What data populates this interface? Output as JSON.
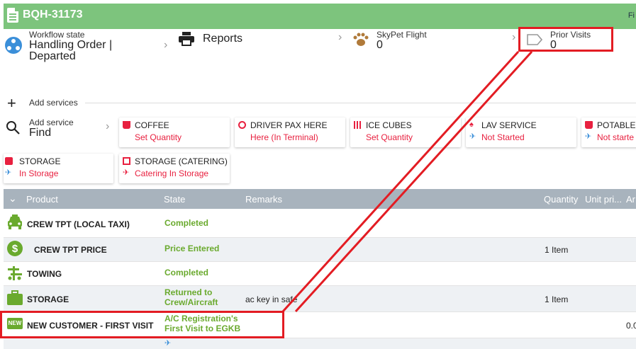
{
  "header": {
    "title": "BQH-31173",
    "right_text": "Fi"
  },
  "workflow": {
    "label": "Workflow state",
    "value_line1": "Handling Order |",
    "value_line2": "Departed"
  },
  "reports": {
    "label": "Reports"
  },
  "skypet": {
    "label": "SkyPet Flight",
    "value": "0"
  },
  "prior_visits": {
    "label": "Prior Visits",
    "value": "0"
  },
  "add_services": {
    "label": "Add services"
  },
  "add_service_find": {
    "label": "Add service",
    "value": "Find"
  },
  "services": [
    {
      "name": "COFFEE",
      "state": "Set Quantity",
      "icon": "coffee-icon"
    },
    {
      "name": "DRIVER PAX HERE",
      "state": "Here (In Terminal)",
      "icon": "face-icon"
    },
    {
      "name": "ICE CUBES",
      "state": "Set Quantity",
      "icon": "grid-icon"
    },
    {
      "name": "LAV SERVICE",
      "state": "Not Started",
      "icon": "restroom-icon"
    },
    {
      "name": "POTABLE",
      "state": "Not starte",
      "icon": "cup-icon"
    },
    {
      "name": "STORAGE",
      "state": "In Storage",
      "icon": "briefcase-icon"
    },
    {
      "name": "STORAGE (CATERING)",
      "state": "Catering In Storage",
      "icon": "storage-icon"
    }
  ],
  "table": {
    "headers": {
      "product": "Product",
      "state": "State",
      "remarks": "Remarks",
      "quantity": "Quantity",
      "unit_price": "Unit pri...",
      "amount": "Ar"
    },
    "rows": [
      {
        "product": "CREW TPT (LOCAL TAXI)",
        "state": "Completed",
        "remarks": "",
        "quantity": "",
        "amount": "",
        "icon": "taxi-icon"
      },
      {
        "product": "CREW TPT PRICE",
        "state": "Price Entered",
        "remarks": "",
        "quantity": "1 Item",
        "amount": "",
        "icon": "dollar-icon"
      },
      {
        "product": "TOWING",
        "state": "Completed",
        "remarks": "",
        "quantity": "",
        "amount": "",
        "icon": "towing-icon"
      },
      {
        "product": "STORAGE",
        "state_line1": "Returned to",
        "state_line2": "Crew/Aircraft",
        "remarks": "ac key in safe",
        "quantity": "1 Item",
        "amount": "",
        "icon": "briefcase-icon"
      },
      {
        "product": "NEW CUSTOMER - FIRST VISIT",
        "state_line1": "A/C Registration's",
        "state_line2": "First Visit to EGKB",
        "remarks": "",
        "quantity": "",
        "amount": "0.0",
        "icon": "new-badge-icon",
        "badge": "NEW"
      }
    ]
  },
  "colors": {
    "header_green": "#7dc47d",
    "state_green": "#6aaa2e",
    "state_red": "#e8203f",
    "highlight_red": "#e31c23",
    "accent_blue": "#3b8fd9"
  }
}
